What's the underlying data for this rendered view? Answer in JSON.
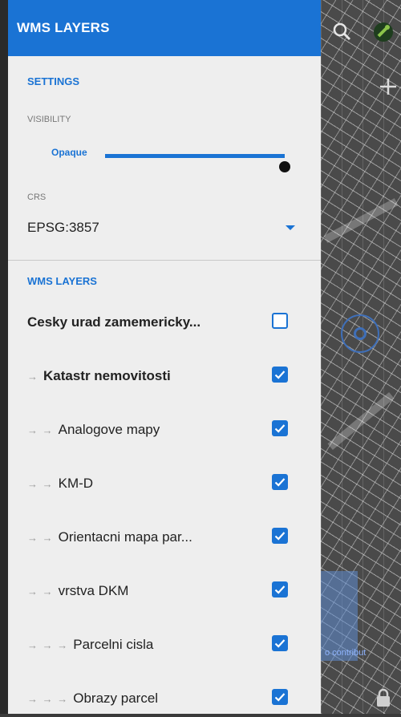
{
  "drawer": {
    "title": "WMS LAYERS",
    "settings_heading": "SETTINGS",
    "visibility_caption": "VISIBILITY",
    "visibility": {
      "label": "Opaque",
      "value": 1.0
    },
    "crs_caption": "CRS",
    "crs_value": "EPSG:3857",
    "layers_heading": "WMS LAYERS",
    "layers": [
      {
        "arrows": "",
        "label": "Cesky urad zamemericky...",
        "bold": true,
        "checked": false
      },
      {
        "arrows": "→",
        "label": "Katastr nemovitosti",
        "bold": true,
        "checked": true
      },
      {
        "arrows": "→ →",
        "label": "Analogove mapy",
        "bold": false,
        "checked": true
      },
      {
        "arrows": "→ →",
        "label": "KM-D",
        "bold": false,
        "checked": true
      },
      {
        "arrows": "→ →",
        "label": "Orientacni mapa par...",
        "bold": false,
        "checked": true
      },
      {
        "arrows": "→ →",
        "label": "vrstva DKM",
        "bold": false,
        "checked": true
      },
      {
        "arrows": "→ → →",
        "label": "Parcelni cisla",
        "bold": false,
        "checked": true
      },
      {
        "arrows": "→ → →",
        "label": "Obrazy parcel",
        "bold": false,
        "checked": true
      }
    ]
  },
  "map": {
    "link_text": "o contribut"
  },
  "colors": {
    "accent": "#1a73d4",
    "drawer_bg": "#eeeeee",
    "text": "#222222"
  },
  "icons": [
    "search-icon",
    "satellite-icon",
    "add-icon",
    "location-icon",
    "lock-icon",
    "dropdown-icon",
    "checkbox-checked-icon"
  ]
}
